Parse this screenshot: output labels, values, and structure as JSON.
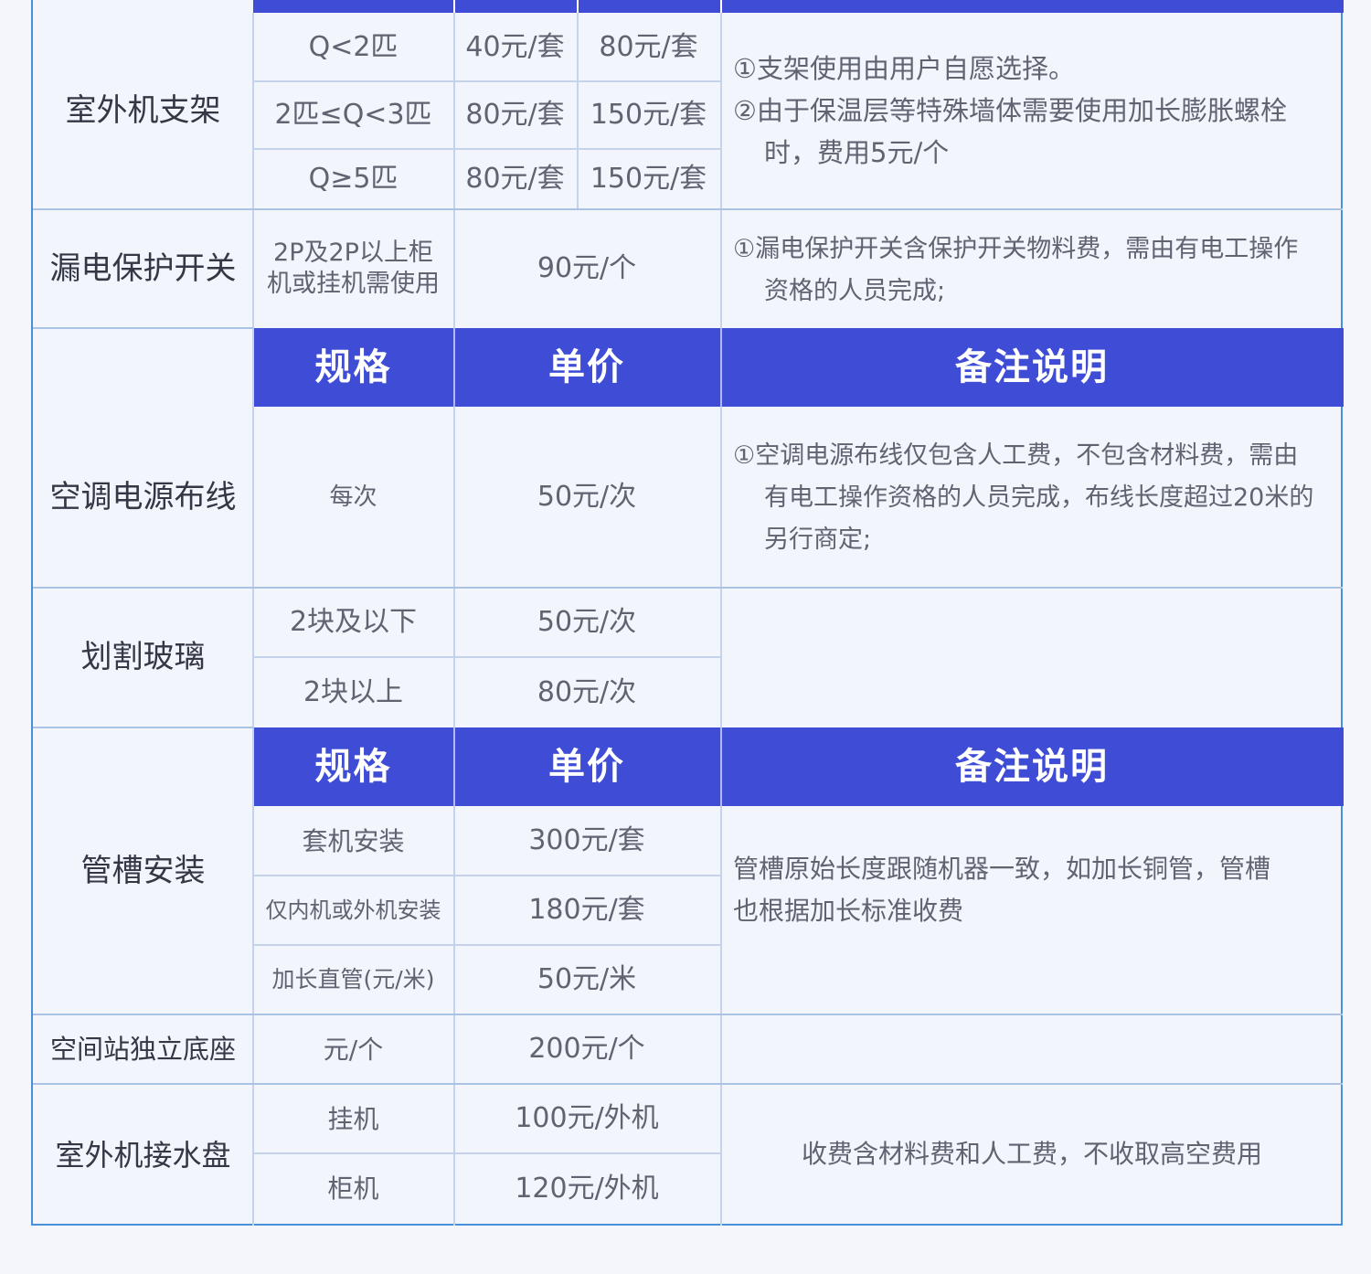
{
  "colors": {
    "header_bg": "#3e4cd6",
    "header_text": "#ffffff",
    "frame_border": "#4a90d9",
    "grid": "#c4d3ea",
    "cell_bg": "#f2f5fc"
  },
  "headers": {
    "spec": "规格",
    "price": "单价",
    "remark": "备注说明"
  },
  "bracket": {
    "category": "室外机支架",
    "rows": [
      {
        "spec": "Q<2匹",
        "price_a": "40元/套",
        "price_b": "80元/套"
      },
      {
        "spec": "2匹≤Q<3匹",
        "price_a": "80元/套",
        "price_b": "150元/套"
      },
      {
        "spec": "Q≥5匹",
        "price_a": "80元/套",
        "price_b": "150元/套"
      }
    ],
    "note1": "①支架使用由用户自愿选择。",
    "note2a": "②由于保温层等特殊墙体需要使用加长膨胀螺栓",
    "note2b": "时，费用5元/个"
  },
  "leakage": {
    "category": "漏电保护开关",
    "spec_line1": "2P及2P以上柜",
    "spec_line2": "机或挂机需使用",
    "price": "90元/个",
    "note_line1": "①漏电保护开关含保护开关物料费，需由有电工操作",
    "note_line2": "资格的人员完成;"
  },
  "wiring": {
    "category": "空调电源布线",
    "spec": "每次",
    "price": "50元/次",
    "note_line1": "①空调电源布线仅包含人工费，不包含材料费，需由",
    "note_line2": "有电工操作资格的人员完成，布线长度超过20米的",
    "note_line3": "另行商定;"
  },
  "glass": {
    "category": "划割玻璃",
    "rows": [
      {
        "spec": "2块及以下",
        "price": "50元/次"
      },
      {
        "spec": "2块以上",
        "price": "80元/次"
      }
    ]
  },
  "duct": {
    "category": "管槽安装",
    "rows": [
      {
        "spec": "套机安装",
        "price": "300元/套"
      },
      {
        "spec": "仅内机或外机安装",
        "price": "180元/套"
      },
      {
        "spec": "加长直管(元/米)",
        "price": "50元/米"
      }
    ],
    "note_line1": "管槽原始长度跟随机器一致，如加长铜管，管槽",
    "note_line2": "也根据加长标准收费"
  },
  "base": {
    "category": "空间站独立底座",
    "spec": "元/个",
    "price": "200元/个"
  },
  "tray": {
    "category": "室外机接水盘",
    "rows": [
      {
        "spec": "挂机",
        "price": "100元/外机"
      },
      {
        "spec": "柜机",
        "price": "120元/外机"
      }
    ],
    "note": "收费含材料费和人工费，不收取高空费用"
  }
}
